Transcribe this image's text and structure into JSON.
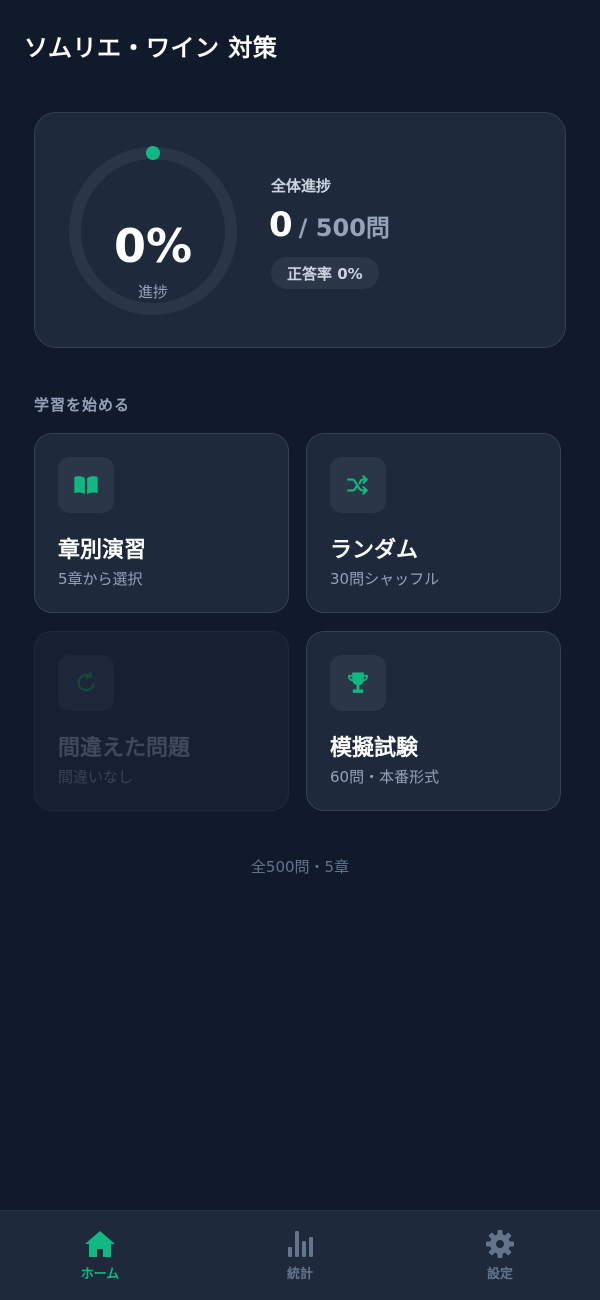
{
  "app": {
    "title": "ソムリエ・ワイン 対策"
  },
  "progress": {
    "percent_text": "0%",
    "percent_value": 0,
    "caption": "進捗",
    "overall_label": "全体進捗",
    "answered": "0",
    "total_text": "/ 500問",
    "accuracy_text": "正答率 0%"
  },
  "section": {
    "title": "学習を始める"
  },
  "modes": [
    {
      "title": "章別演習",
      "subtitle": "5章から選択",
      "icon": "book-icon",
      "enabled": true
    },
    {
      "title": "ランダム",
      "subtitle": "30問シャッフル",
      "icon": "shuffle-icon",
      "enabled": true
    },
    {
      "title": "間違えた問題",
      "subtitle": "間違いなし",
      "icon": "refresh-icon",
      "enabled": false
    },
    {
      "title": "模擬試験",
      "subtitle": "60問・本番形式",
      "icon": "trophy-icon",
      "enabled": true
    }
  ],
  "footer": {
    "note": "全500問・5章"
  },
  "tabs": [
    {
      "label": "ホーム",
      "icon": "home-icon",
      "active": true
    },
    {
      "label": "統計",
      "icon": "bar-chart-icon",
      "active": false
    },
    {
      "label": "設定",
      "icon": "gear-icon",
      "active": false
    }
  ],
  "colors": {
    "accent": "#10b981",
    "background": "#111a2b",
    "card": "#1e293b",
    "muted_text": "#94a3b8"
  }
}
